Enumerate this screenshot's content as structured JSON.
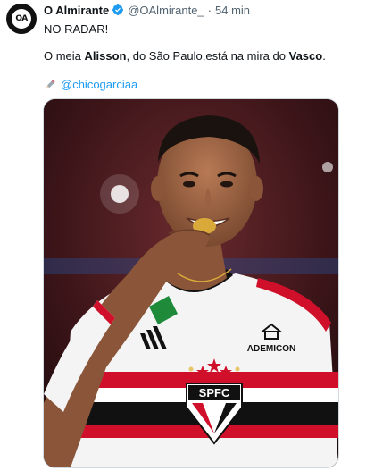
{
  "tweet": {
    "author_name": "O Almirante",
    "handle": "@OAlmirante_",
    "separator": "·",
    "time": "54 min",
    "avatar_text": "OA",
    "line1": "NO RADAR!",
    "line2_parts": [
      "O meia ",
      "Alisson",
      ", do São Paulo,está na mira do ",
      "Vasco",
      "."
    ],
    "mention": "@chicogarciaa",
    "media": {
      "sponsor": "ADEMICON",
      "crest": "SPFC"
    }
  },
  "colors": {
    "link": "#1d9bf0",
    "verified": "#1d9bf0",
    "muted": "#536471",
    "jersey_red": "#d0102a"
  },
  "icons": [
    "verified-badge-icon",
    "pencil-icon"
  ]
}
